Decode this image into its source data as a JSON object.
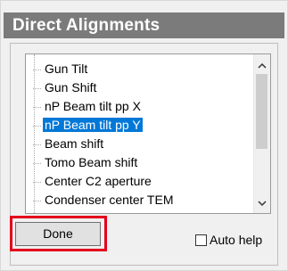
{
  "window": {
    "title": "Direct Alignments"
  },
  "list": {
    "items": [
      {
        "label": "Gun Tilt",
        "selected": false
      },
      {
        "label": "Gun Shift",
        "selected": false
      },
      {
        "label": "nP Beam tilt pp X",
        "selected": false
      },
      {
        "label": "nP Beam tilt pp Y",
        "selected": true
      },
      {
        "label": "Beam shift",
        "selected": false
      },
      {
        "label": "Tomo Beam shift",
        "selected": false
      },
      {
        "label": "Center C2 aperture",
        "selected": false
      },
      {
        "label": "Condenser center TEM",
        "selected": false
      }
    ]
  },
  "buttons": {
    "done_label": "Done"
  },
  "autohelp": {
    "label": "Auto help",
    "checked": false
  },
  "icons": {
    "scroll_up": "chevron-up-icon",
    "scroll_down": "chevron-down-icon"
  },
  "colors": {
    "selection": "#0078d7",
    "highlight": "#e3001b",
    "title_bar": "#7b7b7b"
  }
}
